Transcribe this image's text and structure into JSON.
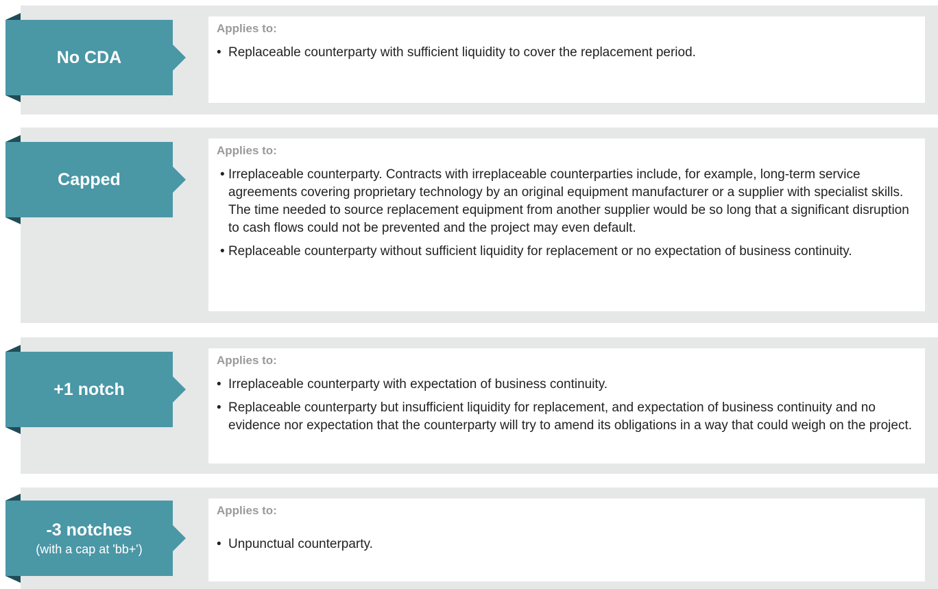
{
  "applies_label": "Applies to:",
  "colors": {
    "tag_bg": "#4a97a6",
    "tag_shadow": "#1f4d57",
    "row_bg": "#e6e7e7",
    "panel_bg": "#ffffff",
    "label_gray": "#9a9a9a"
  },
  "rows": [
    {
      "title": "No CDA",
      "subtitle": "",
      "bullets": [
        "Replaceable counterparty with sufficient liquidity to cover the replacement period."
      ]
    },
    {
      "title": "Capped",
      "subtitle": "",
      "bullets": [
        "Irreplaceable counterparty. Contracts with irreplaceable counterparties include, for example, long-term service agreements covering proprietary technology by an original equipment manufacturer or a supplier with specialist skills. The time needed to source replacement equipment from another supplier would be so long that a significant disruption to cash flows could not be prevented and the project may even default.",
        "Replaceable counterparty without sufficient liquidity for replacement or no expectation of business continuity."
      ]
    },
    {
      "title": "+1 notch",
      "subtitle": "",
      "bullets": [
        "Irreplaceable counterparty with expectation of business continuity.",
        "Replaceable counterparty but insufficient liquidity for replacement, and expectation of business continuity and no evidence nor expectation that the counterparty will try to amend its obligations in a way that could weigh on the project."
      ]
    },
    {
      "title": "-3 notches",
      "subtitle": "(with a cap at 'bb+')",
      "bullets": [
        "Unpunctual counterparty."
      ]
    }
  ]
}
